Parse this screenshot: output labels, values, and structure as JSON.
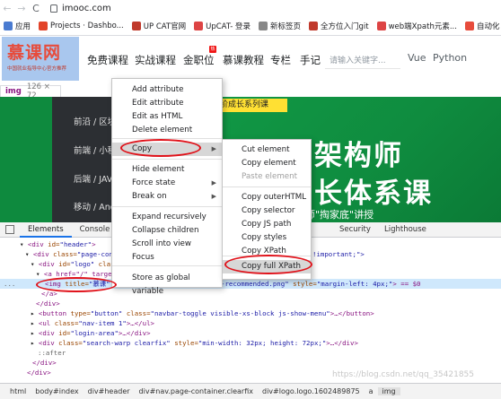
{
  "browser": {
    "back_icon": "←",
    "forward_icon": "→",
    "reload_icon": "C",
    "url": "imooc.com"
  },
  "bookmarks": [
    {
      "label": "应用",
      "color": "#4a7bd1"
    },
    {
      "label": "Projects · Dashbo...",
      "color": "#e24329"
    },
    {
      "label": "UP CAT官网",
      "color": "#c0392b"
    },
    {
      "label": "UpCAT- 登录",
      "color": "#d44"
    },
    {
      "label": "新标签页",
      "color": "#888"
    },
    {
      "label": "全方位入门git",
      "color": "#c0392b"
    },
    {
      "label": "web端Xpath元素...",
      "color": "#d44"
    },
    {
      "label": "自动化",
      "color": "#e74c3c"
    }
  ],
  "site": {
    "logo_main": "慕课网",
    "logo_sub": "中国就业指导中心官方推荐",
    "nav": [
      "免费课程",
      "实战课程",
      "金职位",
      "慕课教程",
      "专栏",
      "手记"
    ],
    "hot_badge": "热",
    "search_placeholder": "请输入关键字...",
    "tags": [
      "Vue",
      "Python"
    ]
  },
  "inspect_tip": {
    "tag": "img",
    "size": "126 × 72"
  },
  "banner": {
    "left_items": [
      "前沿 / 区块",
      "前端 / 小程",
      "后端 / JAV",
      "移动 / Andr"
    ],
    "yellow_text": "进阶成长系列课",
    "big_line1": "架构师",
    "big_line2": "长体系课",
    "small_text": "师\"掏家底\"讲授"
  },
  "context_menu": {
    "items": [
      {
        "label": "Add attribute"
      },
      {
        "label": "Edit attribute"
      },
      {
        "label": "Edit as HTML"
      },
      {
        "label": "Delete element"
      },
      {
        "label": "Copy",
        "submenu": true
      },
      {
        "label": "Hide element"
      },
      {
        "label": "Force state",
        "submenu": true
      },
      {
        "label": "Break on",
        "submenu": true
      },
      {
        "label": "Expand recursively"
      },
      {
        "label": "Collapse children"
      },
      {
        "label": "Scroll into view"
      },
      {
        "label": "Focus"
      },
      {
        "label": "Store as global variable"
      }
    ],
    "arrow": "▶"
  },
  "copy_submenu": {
    "items": [
      {
        "label": "Cut element"
      },
      {
        "label": "Copy element"
      },
      {
        "label": "Paste element",
        "disabled": true
      },
      {
        "label": "Copy outerHTML"
      },
      {
        "label": "Copy selector"
      },
      {
        "label": "Copy JS path"
      },
      {
        "label": "Copy styles"
      },
      {
        "label": "Copy XPath"
      },
      {
        "label": "Copy full XPath"
      }
    ]
  },
  "devtools": {
    "tabs": [
      "Elements",
      "Console"
    ],
    "right_tabs": [
      "Security",
      "Lighthouse"
    ]
  },
  "dom": {
    "l1_open": "<div ",
    "l1_attr": "id=",
    "l1_val": "\"header\"",
    "l1_close": ">",
    "l2_open": "<div ",
    "l2_attr": "class=",
    "l2_val": "\"page-conte",
    "l2_tail": "!important;\">",
    "l3_open": "<div ",
    "l3_attr": "id=",
    "l3_val": "\"logo\"",
    "l3_attr2": " class",
    "l4_text": "<a href=\"/\" target",
    "l5_dots": "...",
    "l5_tag": "<img ",
    "l5_attr": "title=",
    "l5_val": "\"慕课\"",
    "l5_src": "-recommended.png\"",
    "l5_style_attr": " style=",
    "l5_style_val": "\"margin-left: 4px;\"",
    "l5_tail": "> == $0",
    "l6": "</a>",
    "l7": "</div>",
    "l8_open": "<button ",
    "l8_attr": "type=",
    "l8_val": "\"button\"",
    "l8_attr2": " class=",
    "l8_val2": "\"navbar-toggle visible-xs-block js-show-menu\"",
    "l8_tail": ">…</button>",
    "l9_open": "<ul ",
    "l9_attr": "class=",
    "l9_val": "\"nav-item 1\"",
    "l9_tail": ">…</ul>",
    "l10_open": "<div ",
    "l10_attr": "id=",
    "l10_val": "\"login-area\"",
    "l10_tail": ">…</div>",
    "l11_open": "<div ",
    "l11_attr": "class=",
    "l11_val": "\"search-warp clearfix\"",
    "l11_attr2": " style=",
    "l11_val2": "\"min-width: 32px; height: 72px;\"",
    "l11_tail": ">…</div>",
    "l12": "::after",
    "l13": "</div>",
    "l14": "</div>"
  },
  "watermark": "https://blog.csdn.net/qq_35421855",
  "breadcrumbs": [
    "html",
    "body#index",
    "div#header",
    "div#nav.page-container.clearfix",
    "div#logo.logo.1602489875",
    "a",
    "img"
  ],
  "colors": {
    "annotation_red": "#e0121a",
    "banner_green": "#0f8c3f",
    "selection_blue": "#cfe8fc"
  }
}
